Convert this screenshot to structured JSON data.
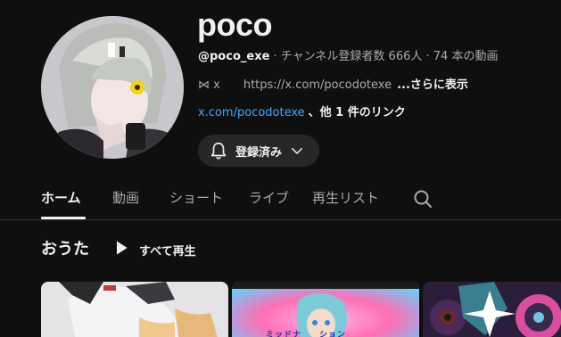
{
  "channel": {
    "name": "poco",
    "handle": "@poco_exe",
    "stats": "· チャンネル登録者数 666人 · 74 本の動画",
    "description_prefix": "⋈ x",
    "description_url": "https://x.com/pocodotexe",
    "description_more": "...さらに表示",
    "link_text": "x.com/pocodotexe",
    "link_suffix": "、他 1 件のリンク",
    "subscribe_label": "登録済み"
  },
  "tabs": [
    {
      "label": "ホーム",
      "active": true
    },
    {
      "label": "動画"
    },
    {
      "label": "ショート"
    },
    {
      "label": "ライブ"
    },
    {
      "label": "再生リスト"
    }
  ],
  "section": {
    "title": "おうた",
    "play_all_label": "すべて再生"
  },
  "thumbnails": [
    {
      "caption": ""
    },
    {
      "caption": "ミッドナ　　ション"
    },
    {
      "caption": ""
    }
  ],
  "colors": {
    "background": "#0f0f0f",
    "link": "#3ea6ff",
    "button_bg": "#272727",
    "secondary_text": "#aaaaaa"
  },
  "icons": {
    "bell": "bell-icon",
    "chevron": "chevron-down-icon",
    "search": "search-icon",
    "play": "play-icon"
  }
}
